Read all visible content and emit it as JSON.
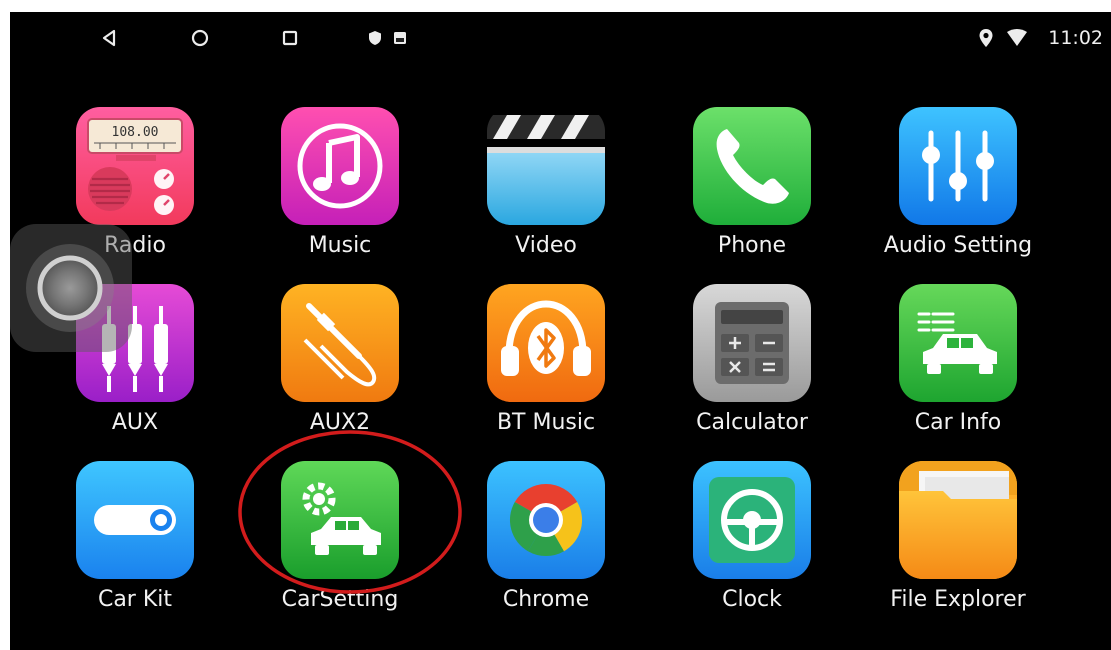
{
  "status_bar": {
    "nav_icons": [
      "back-icon",
      "home-icon",
      "recents-icon",
      "shield-icon",
      "sd-card-icon"
    ],
    "status_icons": [
      "location-pin-icon",
      "wifi-icon"
    ],
    "time": "11:02"
  },
  "apps": [
    {
      "label": "Radio",
      "icon": "radio-icon"
    },
    {
      "label": "Music",
      "icon": "music-note-icon"
    },
    {
      "label": "Video",
      "icon": "clapperboard-icon"
    },
    {
      "label": "Phone",
      "icon": "phone-handset-icon"
    },
    {
      "label": "Audio Setting",
      "icon": "equalizer-icon"
    },
    {
      "label": "AUX",
      "icon": "rca-plugs-icon"
    },
    {
      "label": "AUX2",
      "icon": "audio-jack-icon"
    },
    {
      "label": "BT Music",
      "icon": "bluetooth-headphones-icon"
    },
    {
      "label": "Calculator",
      "icon": "calculator-icon"
    },
    {
      "label": "Car Info",
      "icon": "car-info-icon"
    },
    {
      "label": "Car Kit",
      "icon": "toggle-switch-icon"
    },
    {
      "label": "CarSetting",
      "icon": "car-gear-icon"
    },
    {
      "label": "Chrome",
      "icon": "chrome-icon"
    },
    {
      "label": "Clock",
      "icon": "steering-clock-icon"
    },
    {
      "label": "File Explorer",
      "icon": "folder-icon"
    }
  ],
  "radio_display": "108.00",
  "colors": {
    "background": "#000000",
    "highlight_circle": "#d21c1c",
    "label": "#f2f2f2"
  }
}
